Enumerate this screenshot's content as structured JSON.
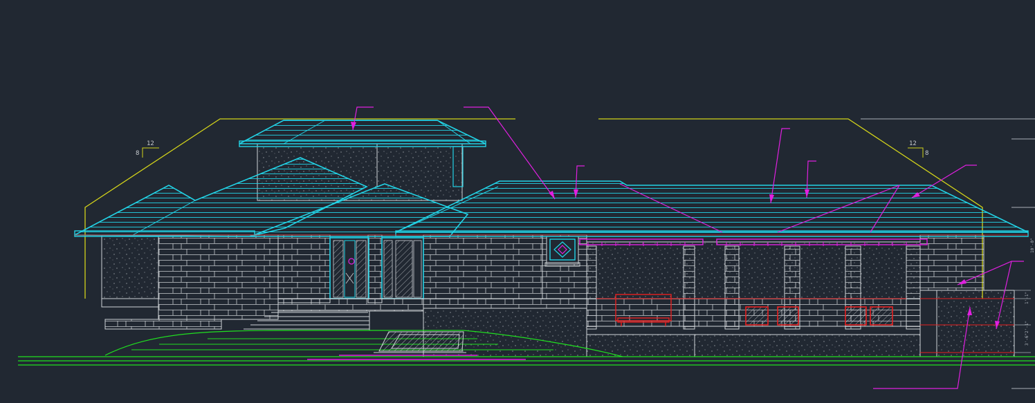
{
  "drawing": {
    "background": "#212832",
    "colors": {
      "roof": "#22d3e6",
      "leader": "#e020e0",
      "outline": "#d0d4d8",
      "slope_line": "#d4d41a",
      "grade": "#20e020",
      "furniture": "#e82020",
      "dim": "#aab0b8"
    },
    "slope_left": {
      "rise": "8",
      "run": "12"
    },
    "slope_right": {
      "rise": "8",
      "run": "12"
    },
    "dimensions": [
      "1'-1\"",
      "2'-1\"",
      "3'-6\"",
      "10'-0\""
    ]
  }
}
